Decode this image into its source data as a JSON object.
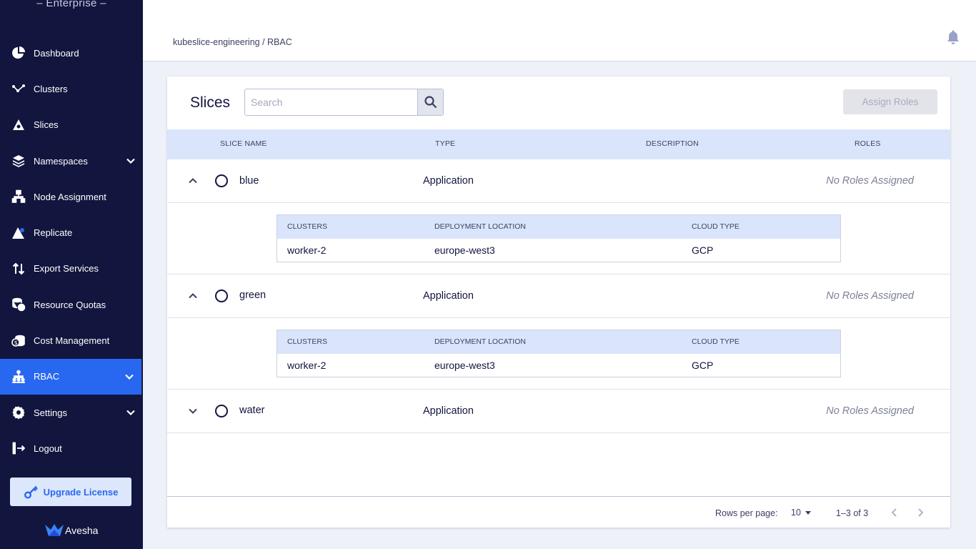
{
  "sidebar": {
    "edition": "– Enterprise –",
    "items": [
      {
        "label": "Dashboard",
        "icon": "pie-chart-icon"
      },
      {
        "label": "Clusters",
        "icon": "clusters-icon"
      },
      {
        "label": "Slices",
        "icon": "slices-icon"
      },
      {
        "label": "Namespaces",
        "icon": "layers-icon"
      },
      {
        "label": "Node Assignment",
        "icon": "node-assignment-icon"
      },
      {
        "label": "Replicate",
        "icon": "replicate-icon"
      },
      {
        "label": "Export Services",
        "icon": "export-arrows-icon"
      },
      {
        "label": "Resource Quotas",
        "icon": "resource-quotas-icon"
      },
      {
        "label": "Cost Management",
        "icon": "cost-icon"
      },
      {
        "label": "RBAC",
        "icon": "rbac-icon"
      },
      {
        "label": "Settings",
        "icon": "gear-icon"
      },
      {
        "label": "Logout",
        "icon": "logout-icon"
      }
    ],
    "upgrade_label": "Upgrade License",
    "logo_text": "Avesha",
    "colors": {
      "background": "#12153e",
      "active": "#2868f0"
    }
  },
  "header": {
    "breadcrumb": "kubeslice-engineering / RBAC"
  },
  "card": {
    "title": "Slices",
    "search_placeholder": "Search",
    "assign_label": "Assign Roles",
    "columns": {
      "name": "SLICE NAME",
      "type": "TYPE",
      "description": "DESCRIPTION",
      "roles": "ROLES"
    },
    "sub_columns": {
      "clusters": "CLUSTERS",
      "location": "DEPLOYMENT LOCATION",
      "cloud": "CLOUD TYPE"
    },
    "slices": [
      {
        "name": "blue",
        "type": "Application",
        "roles": "No Roles Assigned",
        "expanded": true,
        "clusters": [
          {
            "cluster": "worker-2",
            "location": "europe-west3",
            "cloud": "GCP"
          }
        ]
      },
      {
        "name": "green",
        "type": "Application",
        "roles": "No Roles Assigned",
        "expanded": true,
        "clusters": [
          {
            "cluster": "worker-2",
            "location": "europe-west3",
            "cloud": "GCP"
          }
        ]
      },
      {
        "name": "water",
        "type": "Application",
        "roles": "No Roles Assigned",
        "expanded": false,
        "clusters": []
      }
    ],
    "pagination": {
      "rows_label": "Rows per page:",
      "rows_value": "10",
      "range": "1–3 of 3"
    }
  }
}
